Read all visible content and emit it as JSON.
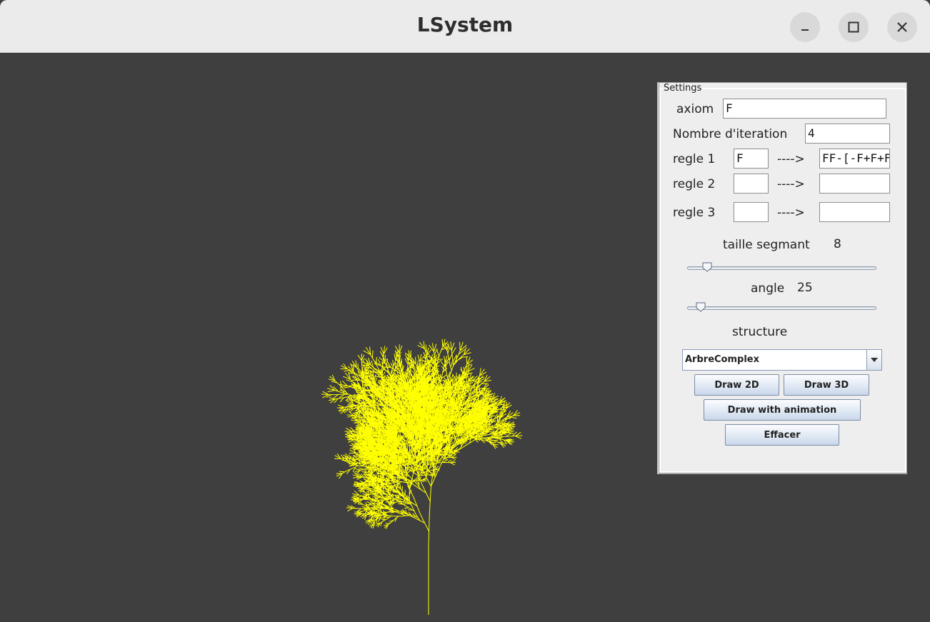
{
  "window": {
    "title": "LSystem"
  },
  "settings": {
    "legend": "Settings",
    "axiom_label": "axiom",
    "axiom_value": "F",
    "iterations_label": "Nombre d'iteration",
    "iterations_value": "4",
    "rules": [
      {
        "label": "regle 1",
        "input": "F",
        "arrow": "---->",
        "output": "FF-[-F+F+F"
      },
      {
        "label": "regle 2",
        "input": "",
        "arrow": "---->",
        "output": ""
      },
      {
        "label": "regle 3",
        "input": "",
        "arrow": "---->",
        "output": ""
      }
    ],
    "segment_label": "taille segmant",
    "segment_value": "8",
    "angle_label": "angle",
    "angle_value": "25",
    "structure_label": "structure",
    "structure_selected": "ArbreComplex",
    "buttons": {
      "draw2d": "Draw 2D",
      "draw3d": "Draw 3D",
      "animate": "Draw with animation",
      "clear": "Effacer"
    }
  },
  "colors": {
    "canvas_bg": "#3f3f3f",
    "stroke": "#ffff00"
  }
}
